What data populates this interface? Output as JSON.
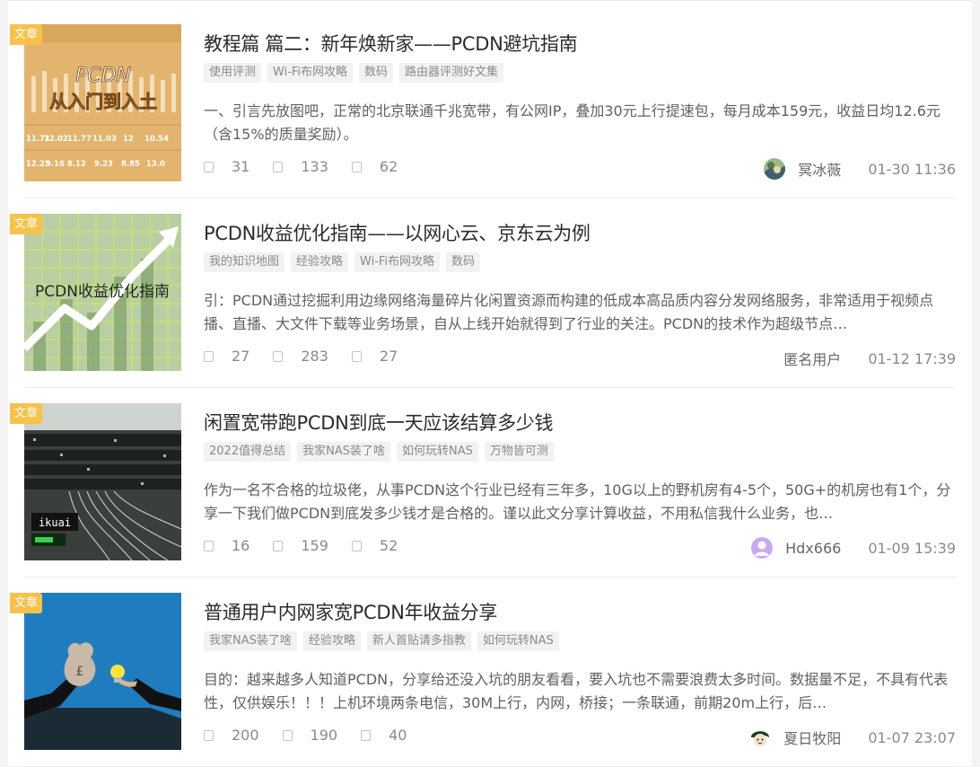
{
  "badge_label": "文章",
  "articles": [
    {
      "title": "教程篇 篇二：新年焕新家——PCDN避坑指南",
      "tags": [
        "使用评测",
        "Wi-Fi布网攻略",
        "数码",
        "路由器评测好文集"
      ],
      "summary": "一、引言先放图吧，正常的北京联通千兆宽带，有公网IP，叠加30元上行提速包，每月成本159元，收益日均12.6元（含15%的质量奖励）。",
      "likes": "31",
      "favorites": "133",
      "comments": "62",
      "author": "冥冰薇",
      "time": "01-30 11:36",
      "thumb_text": [
        "PCDN",
        "从入门到入土"
      ],
      "thumb_numbers": [
        "11.71",
        "12.02",
        "11.77",
        "11.03",
        "12",
        "10.54",
        "12.25",
        "9.16",
        "8.12",
        "9.23",
        "8.85",
        "13.0"
      ],
      "thumb_icon": "pcdn-chart-cover",
      "avatar_icon": "landscape-avatar"
    },
    {
      "title": "PCDN收益优化指南——以网心云、京东云为例",
      "tags": [
        "我的知识地图",
        "经验攻略",
        "Wi-Fi布网攻略",
        "数码"
      ],
      "summary": "引：PCDN通过挖掘利用边缘网络海量碎片化闲置资源而构建的低成本高品质内容分发网络服务，非常适用于视频点播、直播、大文件下载等业务场景，自从上线开始就得到了行业的关注。PCDN的技术作为超级节点…",
      "likes": "27",
      "favorites": "283",
      "comments": "27",
      "author": "匿名用户",
      "time": "01-12 17:39",
      "thumb_text": [
        "PCDN收益优化指南"
      ],
      "thumb_icon": "growth-arrow-cover",
      "avatar_icon": ""
    },
    {
      "title": "闲置宽带跑PCDN到底一天应该结算多少钱",
      "tags": [
        "2022值得总结",
        "我家NAS装了啥",
        "如何玩转NAS",
        "万物皆可测"
      ],
      "summary": "作为一名不合格的垃圾佬，从事PCDN这个行业已经有三年多，10G以上的野机房有4-5个，50G+的机房也有1个，分享一下我们做PCDN到底发多少钱才是合格的。谨以此文分享计算收益，不用私信我什么业务，也…",
      "likes": "16",
      "favorites": "159",
      "comments": "52",
      "author": "Hdx666",
      "time": "01-09 15:39",
      "thumb_text": [
        "ikuai"
      ],
      "thumb_icon": "server-rack-cover",
      "avatar_icon": "user-avatar"
    },
    {
      "title": "普通用户内网家宽PCDN年收益分享",
      "tags": [
        "我家NAS装了啥",
        "经验攻略",
        "新人首贴请多指教",
        "如何玩转NAS"
      ],
      "summary": "目的：越来越多人知道PCDN，分享给还没入坑的朋友看看，要入坑也不需要浪费太多时间。数据量不足，不具有代表性，仅供娱乐！！！上机环境两条电信，30M上行，内网，桥接；一条联通，前期20m上行，后…",
      "likes": "200",
      "favorites": "190",
      "comments": "40",
      "author": "夏日牧阳",
      "time": "01-07 23:07",
      "thumb_text": [
        "£"
      ],
      "thumb_icon": "money-idea-cover",
      "avatar_icon": "cartoon-avatar"
    }
  ]
}
